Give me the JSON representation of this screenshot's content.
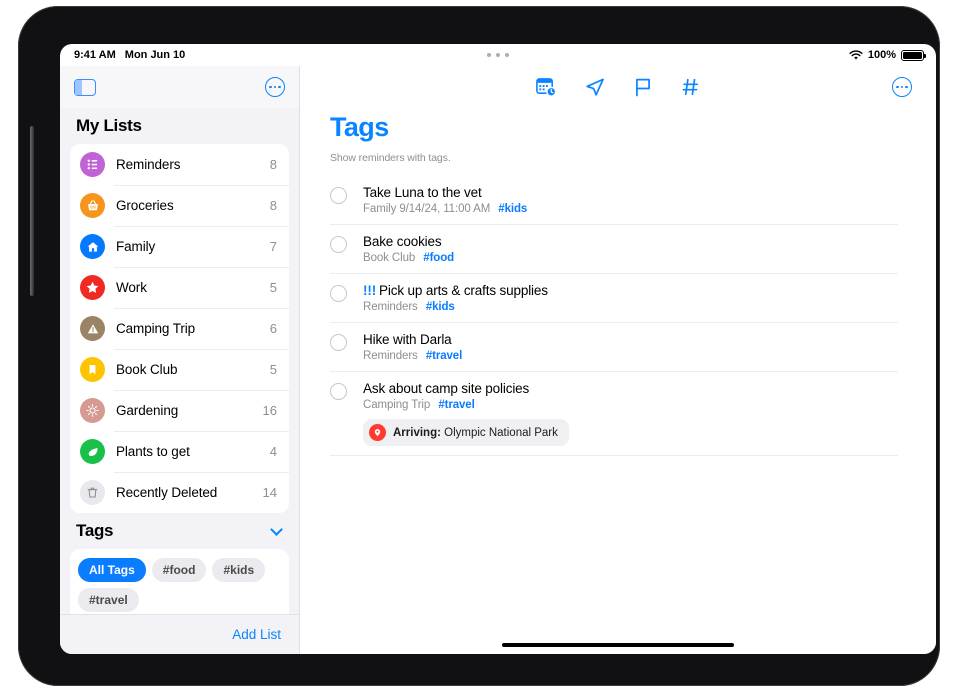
{
  "status_bar": {
    "time": "9:41 AM",
    "date": "Mon Jun 10",
    "wifi_icon": "wifi-icon",
    "battery_percent": "100%",
    "battery_icon": "battery-full-icon",
    "multitask_icon": "multitask-dots-icon"
  },
  "sidebar": {
    "toggle_icon": "sidebar-toggle-icon",
    "more_icon": "more-options-icon",
    "my_lists_title": "My Lists",
    "lists": [
      {
        "label": "Reminders",
        "count": "8",
        "icon": "list-bullet-icon",
        "color": "#c063d6"
      },
      {
        "label": "Groceries",
        "count": "8",
        "icon": "basket-icon",
        "color": "#f6951e"
      },
      {
        "label": "Family",
        "count": "7",
        "icon": "house-icon",
        "color": "#067aff"
      },
      {
        "label": "Work",
        "count": "5",
        "icon": "star-icon",
        "color": "#f02a22"
      },
      {
        "label": "Camping Trip",
        "count": "6",
        "icon": "tent-triangle-icon",
        "color": "#9b8465"
      },
      {
        "label": "Book Club",
        "count": "5",
        "icon": "bookmark-icon",
        "color": "#ffc400"
      },
      {
        "label": "Gardening",
        "count": "16",
        "icon": "sun-flower-icon",
        "color": "#d59a91"
      },
      {
        "label": "Plants to get",
        "count": "4",
        "icon": "leaf-icon",
        "color": "#19c14b"
      },
      {
        "label": "Recently Deleted",
        "count": "14",
        "icon": "trash-icon",
        "color": "#e8e8ed"
      }
    ],
    "tags_title": "Tags",
    "tags_chevron_icon": "chevron-down-icon",
    "tags": [
      {
        "label": "All Tags",
        "selected": true
      },
      {
        "label": "#food",
        "selected": false
      },
      {
        "label": "#kids",
        "selected": false
      },
      {
        "label": "#travel",
        "selected": false
      }
    ],
    "add_list_label": "Add List"
  },
  "content": {
    "toolbar_icons": [
      {
        "name": "scheduled-calendar-icon"
      },
      {
        "name": "location-arrow-icon"
      },
      {
        "name": "flag-icon"
      },
      {
        "name": "hashtag-icon"
      }
    ],
    "more_icon": "more-options-icon",
    "title": "Tags",
    "subtitle": "Show reminders with tags.",
    "reminders": [
      {
        "title": "Take Luna to the vet",
        "priority": "",
        "list": "Family",
        "date": "9/14/24, 11:00 AM",
        "tag": "#kids",
        "location_badge": null
      },
      {
        "title": "Bake cookies",
        "priority": "",
        "list": "Book Club",
        "date": "",
        "tag": "#food",
        "location_badge": null
      },
      {
        "title": "Pick up arts & crafts supplies",
        "priority": "!!!",
        "list": "Reminders",
        "date": "",
        "tag": "#kids",
        "location_badge": null
      },
      {
        "title": "Hike with Darla",
        "priority": "",
        "list": "Reminders",
        "date": "",
        "tag": "#travel",
        "location_badge": null
      },
      {
        "title": "Ask about camp site policies",
        "priority": "",
        "list": "Camping Trip",
        "date": "",
        "tag": "#travel",
        "location_badge": {
          "icon": "location-pin-icon",
          "label": "Arriving:",
          "value": "Olympic National Park"
        }
      }
    ]
  },
  "home_indicator": "home-indicator"
}
